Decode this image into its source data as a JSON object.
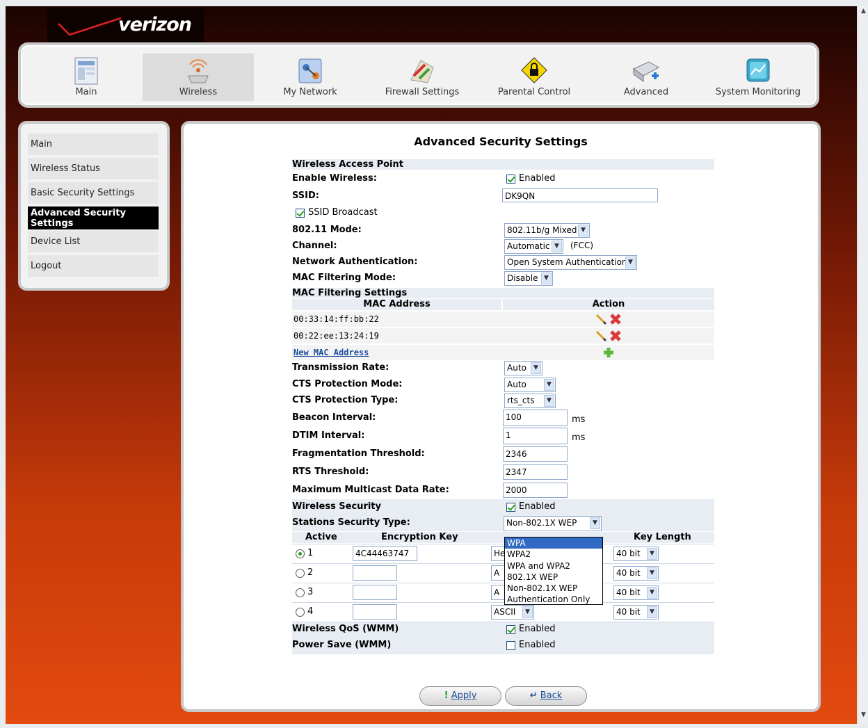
{
  "brand": {
    "logo_text": "verizon"
  },
  "topnav": [
    {
      "label": "Main",
      "icon": "main-page-icon"
    },
    {
      "label": "Wireless",
      "icon": "wireless-icon",
      "selected": true
    },
    {
      "label": "My Network",
      "icon": "network-icon"
    },
    {
      "label": "Firewall Settings",
      "icon": "firewall-icon"
    },
    {
      "label": "Parental Control",
      "icon": "lock-warning-icon"
    },
    {
      "label": "Advanced",
      "icon": "advanced-icon"
    },
    {
      "label": "System Monitoring",
      "icon": "monitor-icon"
    }
  ],
  "sidebar": [
    {
      "label": "Main"
    },
    {
      "label": "Wireless Status"
    },
    {
      "label": "Basic Security Settings"
    },
    {
      "label": "Advanced Security Settings",
      "selected": true
    },
    {
      "label": "Device List"
    },
    {
      "label": "Logout"
    }
  ],
  "page_title": "Advanced Security Settings",
  "form": {
    "wap_section": "Wireless Access Point",
    "enable_wireless_label": "Enable Wireless:",
    "enable_wireless_value": "Enabled",
    "ssid_label": "SSID:",
    "ssid_value": "DK9QN",
    "ssid_broadcast_label": "SSID Broadcast",
    "mode_label": "802.11 Mode:",
    "mode_value": "802.11b/g Mixed",
    "channel_label": "Channel:",
    "channel_value": "Automatic",
    "channel_note": "(FCC)",
    "auth_label": "Network Authentication:",
    "auth_value": "Open System Authentication",
    "mac_mode_label": "MAC Filtering Mode:",
    "mac_mode_value": "Disable",
    "mac_settings_section": "MAC Filtering Settings",
    "mac_col_address": "MAC Address",
    "mac_col_action": "Action",
    "mac_rows": [
      "00:33:14:ff:bb:22",
      "00:22:ee:13:24:19"
    ],
    "new_mac_link": "New MAC Address",
    "tx_rate_label": "Transmission Rate:",
    "tx_rate_value": "Auto",
    "cts_mode_label": "CTS Protection Mode:",
    "cts_mode_value": "Auto",
    "cts_type_label": "CTS Protection Type:",
    "cts_type_value": "rts_cts",
    "beacon_label": "Beacon Interval:",
    "beacon_value": "100",
    "beacon_unit": "ms",
    "dtim_label": "DTIM Interval:",
    "dtim_value": "1",
    "dtim_unit": "ms",
    "frag_label": "Fragmentation Threshold:",
    "frag_value": "2346",
    "rts_label": "RTS Threshold:",
    "rts_value": "2347",
    "mcast_label": "Maximum Multicast Data Rate:",
    "mcast_value": "2000",
    "wsec_label": "Wireless Security",
    "wsec_value": "Enabled",
    "sst_label": "Stations Security Type:",
    "sst_value": "Non-802.1X WEP",
    "key_cols": {
      "active": "Active",
      "key": "Encryption Key",
      "length": "Key Length"
    },
    "keys": [
      {
        "num": "1",
        "value": "4C44463747",
        "entry": "He",
        "length": "40 bit"
      },
      {
        "num": "2",
        "value": "",
        "entry": "A",
        "length": "40 bit"
      },
      {
        "num": "3",
        "value": "",
        "entry": "A",
        "length": "40 bit"
      },
      {
        "num": "4",
        "value": "",
        "entry": "ASCII",
        "length": "40 bit"
      }
    ],
    "qos_label": "Wireless QoS (WMM)",
    "qos_value": "Enabled",
    "psave_label": "Power Save (WMM)",
    "psave_value": "Enabled"
  },
  "security_type_options": [
    "WPA",
    "WPA2",
    "WPA and WPA2",
    "802.1X WEP",
    "Non-802.1X WEP",
    "Authentication Only"
  ],
  "buttons": {
    "apply": "Apply",
    "back": "Back"
  },
  "colors": {
    "accent": "#e24a0e",
    "link": "#1b4e9c",
    "highlight": "#316ac5"
  }
}
